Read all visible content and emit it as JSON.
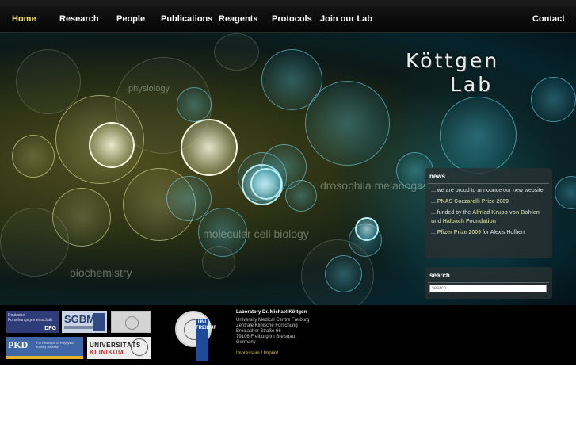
{
  "nav": {
    "items": [
      {
        "label": "Home",
        "active": true
      },
      {
        "label": "Research"
      },
      {
        "label": "People"
      },
      {
        "label": "Publications"
      },
      {
        "label": "Reagents"
      },
      {
        "label": "Protocols"
      },
      {
        "label": "Join our Lab"
      }
    ],
    "contact_label": "Contact"
  },
  "logo": {
    "line1": "Köttgen",
    "line2": "Lab"
  },
  "hero_words": {
    "physiology": "physiology",
    "drosophila": "drosophila melanogaster",
    "cell_biology": "molecular cell biology",
    "biochemistry": "biochemistry"
  },
  "news": {
    "title": "news",
    "items": [
      {
        "prefix": "... we are proud to announce our new website",
        "highlight": "",
        "suffix": ""
      },
      {
        "prefix": "... ",
        "highlight": "PNAS Cozzarelli Prize 2009",
        "suffix": ""
      },
      {
        "prefix": "... funded by the ",
        "highlight": "Alfried Krupp von Bohlen und Halbach Foundation",
        "suffix": ""
      },
      {
        "prefix": "... ",
        "highlight": "Pfizer Prize 2009",
        "suffix": " for Alexis Hofherr"
      }
    ]
  },
  "search": {
    "title": "search",
    "placeholder": "search"
  },
  "partners": {
    "dfg_line1": "Deutsche",
    "dfg_line2": "Forschungsgemeinschaft",
    "dfg_abbr": "DFG",
    "sgbm": "SGBM",
    "pkd": "PKD",
    "pkd_sub": "For Research in Polycystic Kidney Disease",
    "uk_a": "UNIVERSITÄTS",
    "uk_b": "KLINIKUM",
    "unifr": "UNI FREIBURG"
  },
  "address": {
    "title": "Laboratory Dr. Michael Köttgen",
    "lines": [
      "University Medical Centre Freiburg",
      "Zentrale Klinische Forschung",
      "Breisacher Straße 66",
      "79106 Freiburg im Breisgau",
      "Germany"
    ],
    "impressum": "Impressum / Imprint"
  },
  "colors": {
    "active_nav": "#f1e07b",
    "news_highlight": "#b4bc8d",
    "impressum": "#d7c55a"
  }
}
